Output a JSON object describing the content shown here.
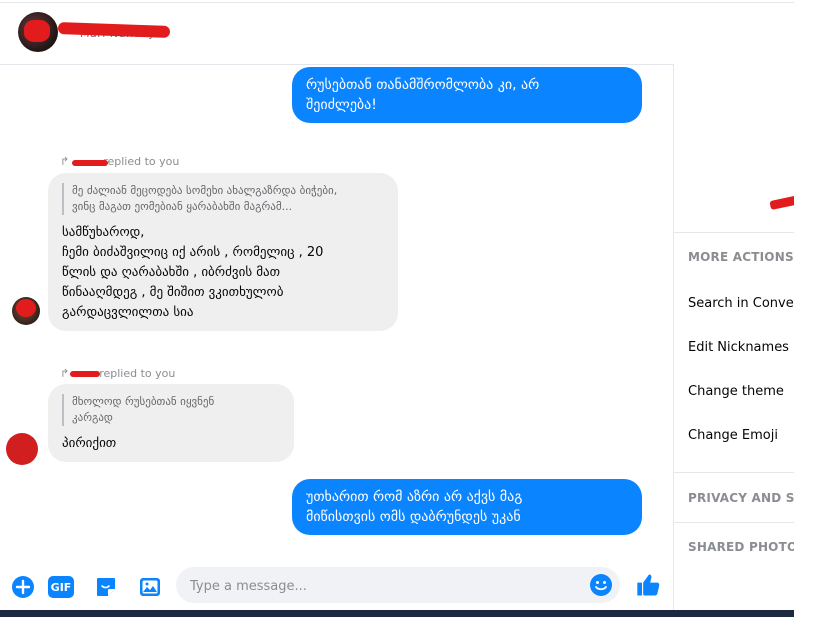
{
  "header": {
    "contact_name": "Mari Nunuay"
  },
  "messages": {
    "m1": {
      "lines": [
        "რუსებთან თანამშრომლობა კი, არ",
        "შეიძლება!"
      ]
    },
    "m2": {
      "replied": "replied to you",
      "quote": [
        "მე ძალიან მეცოდება სომეხი ახალგაზრდა ბიჭები,",
        "ვინც მაგათ ეომებიან ყარაბახში მაგრამ..."
      ],
      "lines": [
        "სამწუხაროდ,",
        "ჩემი ბიძაშვილიც იქ არის , რომელიც , 20",
        "წლის და ღარაბახში , იბრძვის მათ",
        "წინააღმდეგ , მე შიშით ვკითხულობ",
        "გარდაცვლილთა სია"
      ]
    },
    "m3": {
      "replied": "replied to you",
      "quote": [
        "მხოლოდ რუსებთან იყვნენ",
        "კარგად"
      ],
      "lines": [
        "პირიქით"
      ]
    },
    "m4": {
      "lines": [
        "უთხარით რომ აზრი არ აქვს მაგ",
        "მიწისთვის ომს დაბრუნდეს უკან"
      ]
    }
  },
  "composer": {
    "placeholder": "Type a message...",
    "gif_label": "GIF"
  },
  "right_panel": {
    "more_actions": "MORE ACTIONS",
    "items": [
      "Search in Conver",
      "Edit Nicknames",
      "Change theme",
      "Change Emoji"
    ],
    "privacy": "PRIVACY AND SU",
    "shared_photos": "SHARED PHOTOS"
  },
  "colors": {
    "messenger_blue": "#0a84ff",
    "incoming_bubble": "#efefef",
    "redaction_red": "#e21c1c"
  }
}
